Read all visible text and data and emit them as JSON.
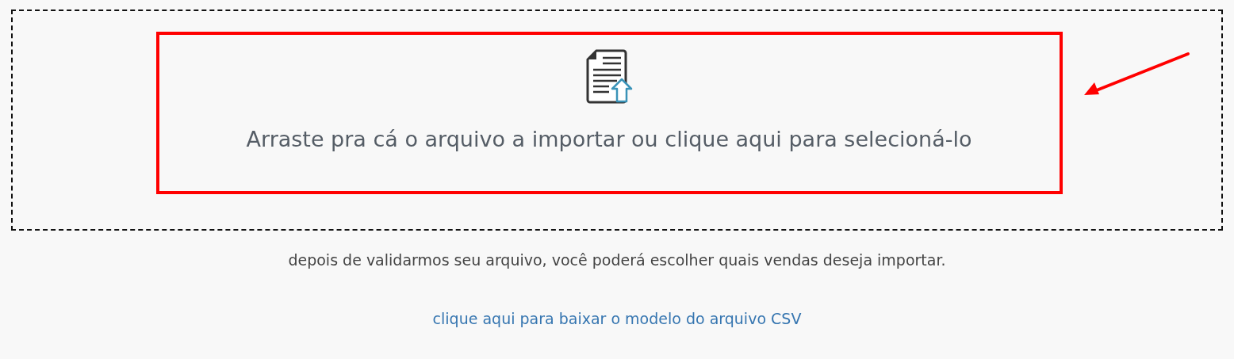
{
  "dropzone": {
    "label": "Arraste pra cá o arquivo a importar ou clique aqui para selecioná-lo"
  },
  "hint": "depois de validarmos seu arquivo, você poderá escolher quais vendas deseja importar.",
  "download_link": "clique aqui para baixar o modelo do arquivo CSV"
}
